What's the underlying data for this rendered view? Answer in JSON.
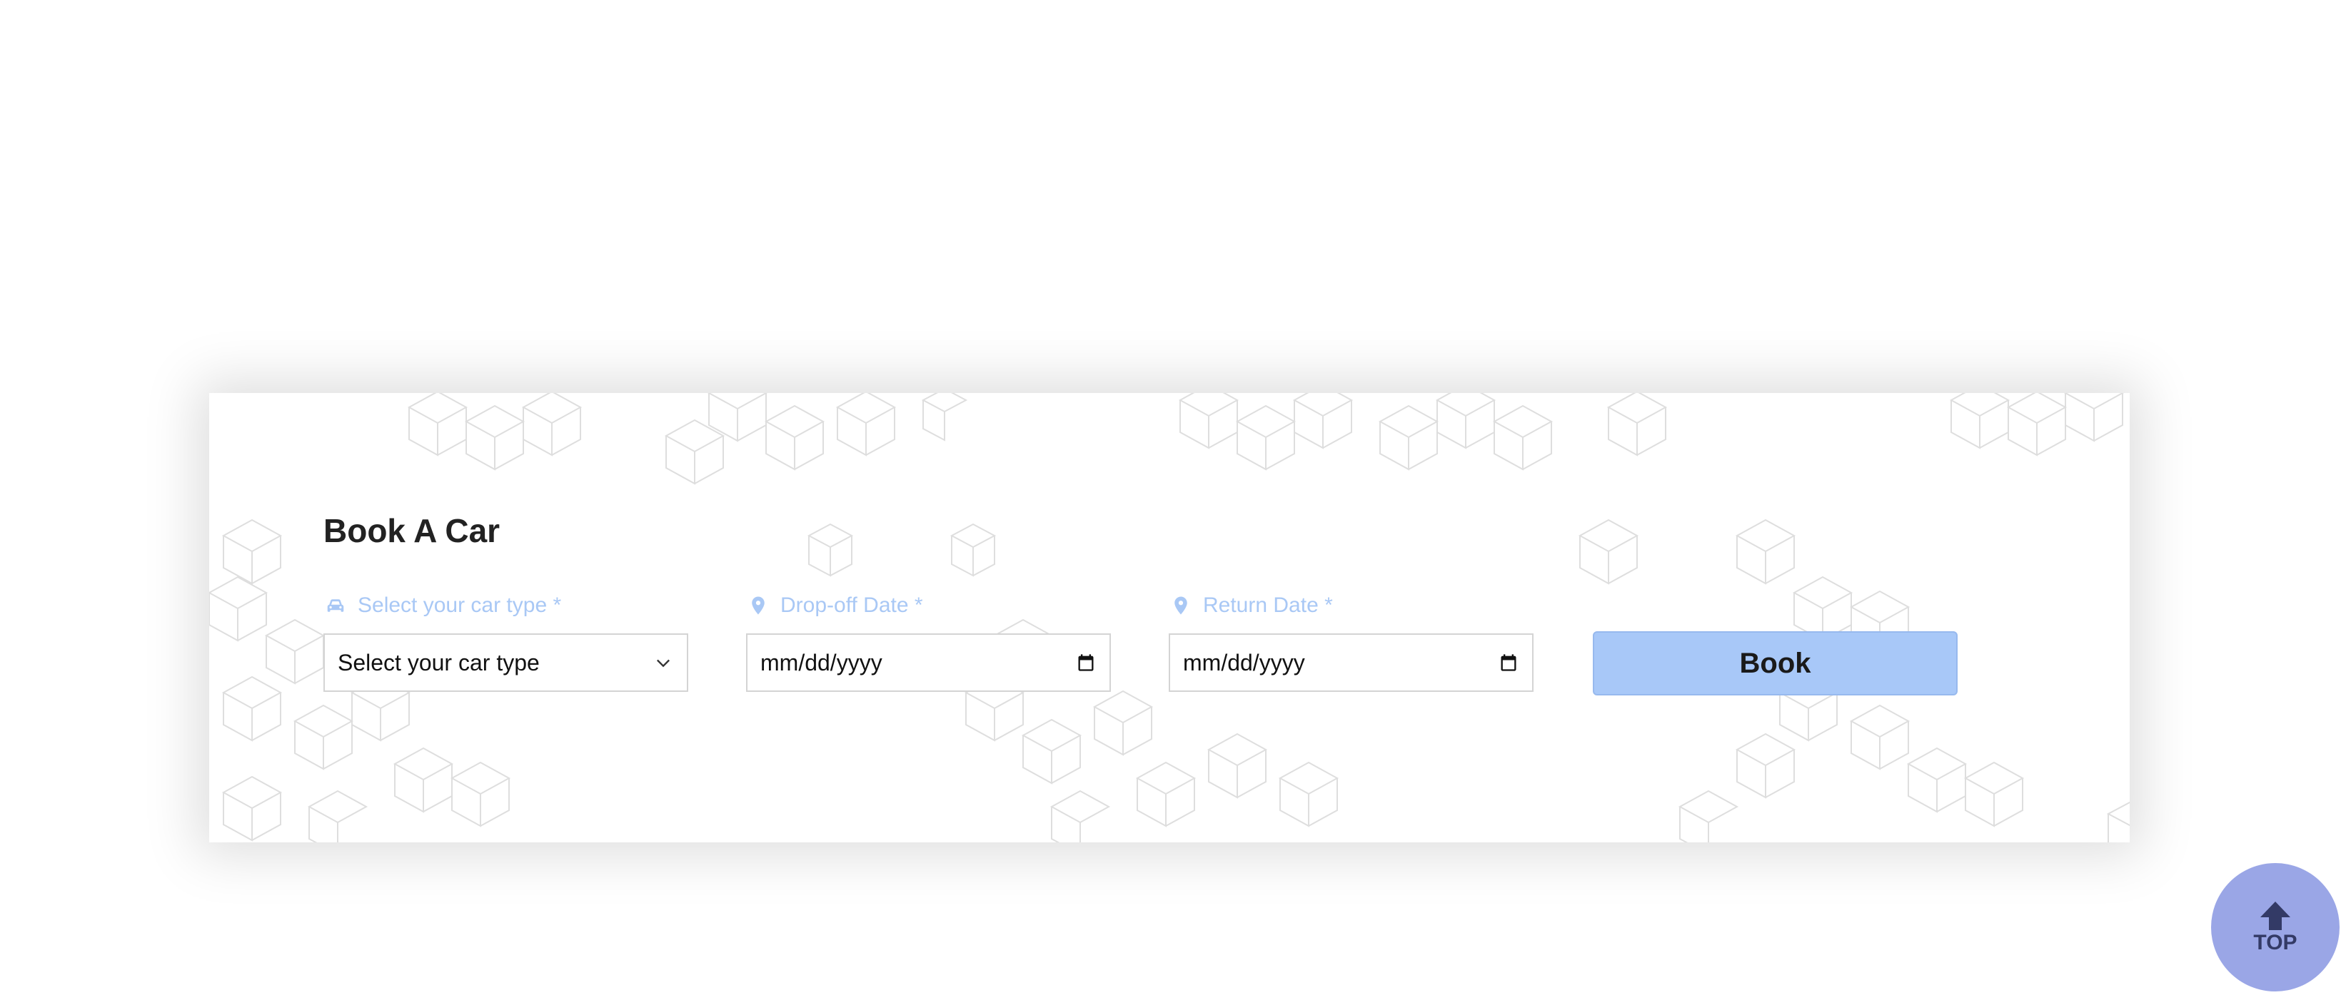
{
  "booking": {
    "title": "Book A Car",
    "car_type": {
      "label": "Select your car type *",
      "icon": "car-icon",
      "value": "Select your car type",
      "trail_icon": "chevron-down-icon"
    },
    "dropoff_date": {
      "label": "Drop-off Date *",
      "icon": "map-pin-icon",
      "value": "mm/dd/yyyy",
      "trail_icon": "calendar-icon"
    },
    "return_date": {
      "label": "Return Date *",
      "icon": "map-pin-icon",
      "value": "mm/dd/yyyy",
      "trail_icon": "calendar-icon"
    },
    "book_label": "Book"
  },
  "scroll_top": {
    "icon": "arrow-up-icon",
    "label": "TOP"
  },
  "colors": {
    "label": "#a9c8f5",
    "book_button": "#a8c8f8",
    "top_button": "#9aa6e6",
    "title": "#222222"
  }
}
